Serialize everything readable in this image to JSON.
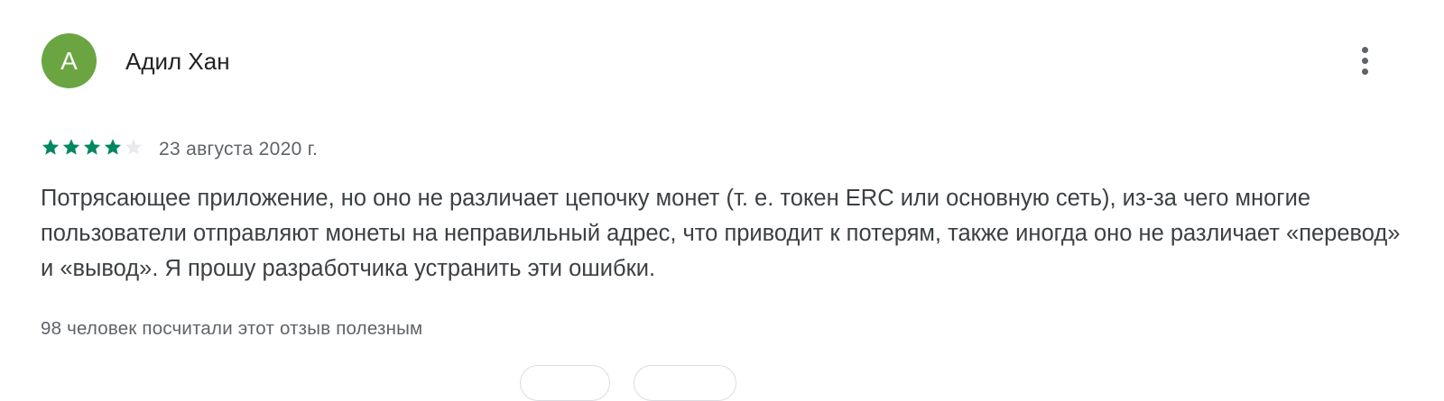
{
  "review": {
    "author": {
      "name": "Адил Хан",
      "initial": "А",
      "avatar_color": "#6aa542"
    },
    "rating": {
      "value": 4,
      "max": 5,
      "filled_color": "#01875f",
      "empty_color": "#e8eaed"
    },
    "date": "23 августа 2020 г.",
    "text": "Потрясающее приложение, но оно не различает цепочку монет (т. е. токен ERC или основную сеть), из-за чего многие пользователи отправляют монеты на неправильный адрес, что приводит к потерям, также иногда оно не различает «перевод» и «вывод». Я прошу разработчика устранить эти ошибки.",
    "helpful_text": "98 человек посчитали этот отзыв полезным",
    "menu_icon": "more-vert-icon"
  }
}
